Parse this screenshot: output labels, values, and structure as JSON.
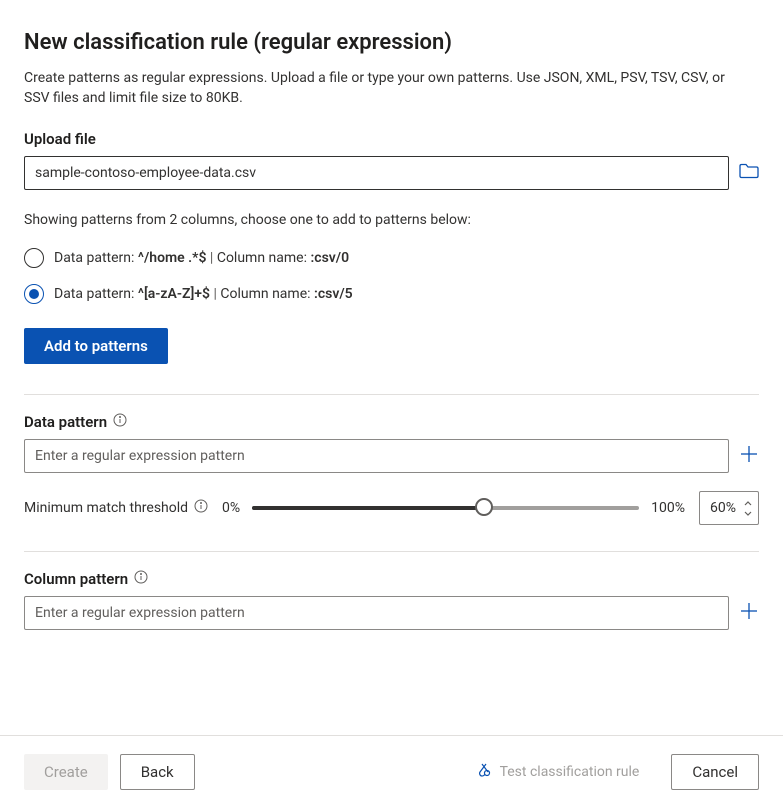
{
  "title": "New classification rule (regular expression)",
  "description": "Create patterns as regular expressions. Upload a file or type your own patterns. Use JSON, XML, PSV, TSV, CSV, or SSV files and limit file size to 80KB.",
  "upload": {
    "label": "Upload file",
    "value": "sample-contoso-employee-data.csv"
  },
  "columns": {
    "showing_text": "Showing patterns from 2 columns, choose one to add to patterns below:",
    "options": [
      {
        "selected": false,
        "prefix": "Data pattern: ",
        "pattern": "^/home .*$",
        "sep": " | ",
        "col_prefix": "Column name: ",
        "col_name": ":csv/0"
      },
      {
        "selected": true,
        "prefix": "Data pattern: ",
        "pattern": "^[a-zA-Z]+$",
        "sep": " | ",
        "col_prefix": "Column name: ",
        "col_name": ":csv/5"
      }
    ],
    "add_button": "Add to patterns"
  },
  "data_pattern": {
    "label": "Data pattern",
    "placeholder": "Enter a regular expression pattern"
  },
  "threshold": {
    "label": "Minimum match threshold",
    "min": "0%",
    "max": "100%",
    "value": "60%",
    "percent": 60
  },
  "column_pattern": {
    "label": "Column pattern",
    "placeholder": "Enter a regular expression pattern"
  },
  "footer": {
    "create": "Create",
    "back": "Back",
    "test": "Test classification rule",
    "cancel": "Cancel"
  }
}
